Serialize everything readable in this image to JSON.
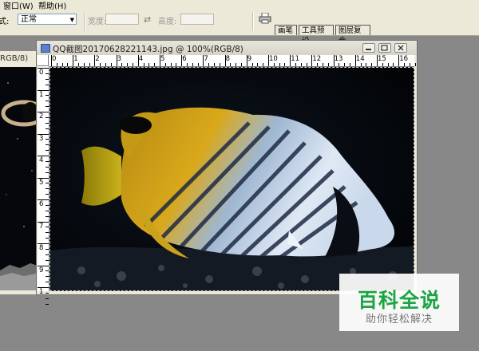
{
  "menu": {
    "items": [
      {
        "label": "窗口(W)"
      },
      {
        "label": "帮助(H)"
      }
    ]
  },
  "options": {
    "style_label": "式:",
    "style_value": "正常",
    "width_label": "宽度:",
    "height_label": "高度:",
    "swap_symbol": "⇄",
    "tabs": [
      {
        "label": "画笔"
      },
      {
        "label": "工具预设"
      },
      {
        "label": "图层复合"
      }
    ]
  },
  "background_doc": {
    "title_fragment": "RGB/8)"
  },
  "document": {
    "title": "QQ截图20170628221143.jpg @ 100%(RGB/8)",
    "ruler_h": [
      "0",
      "1",
      "2",
      "3",
      "4",
      "5",
      "6",
      "7",
      "8",
      "9",
      "10",
      "11",
      "12",
      "13",
      "14",
      "15",
      "16"
    ],
    "ruler_v": [
      "0",
      "1",
      "2",
      "3",
      "4",
      "5",
      "6",
      "7",
      "8",
      "9",
      "1"
    ],
    "image_subject": "butterflyfish photo"
  },
  "watermark": {
    "brand": "百科全说",
    "tagline": "助你轻松解决"
  },
  "colors": {
    "ui_bg": "#ece9d8",
    "workspace": "#888888",
    "watermark_green": "#1aa442"
  }
}
